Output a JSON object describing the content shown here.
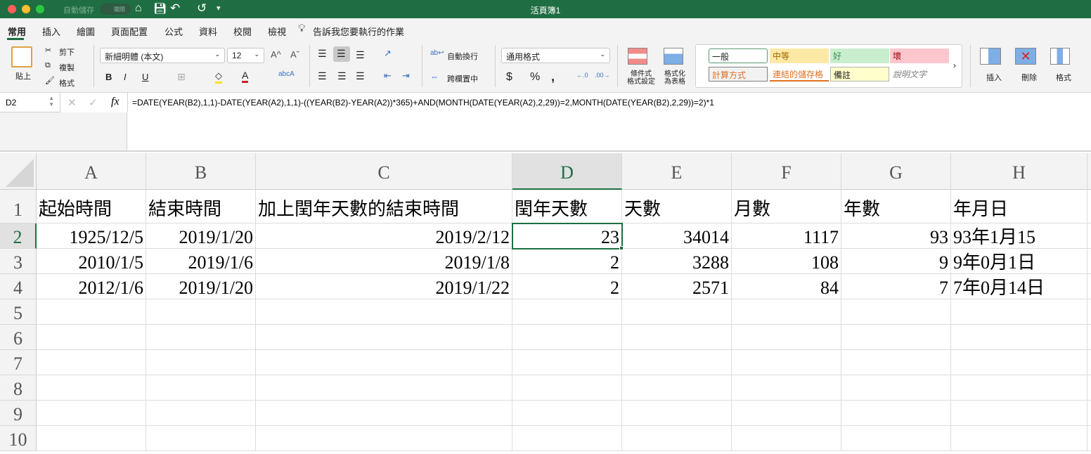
{
  "titlebar": {
    "title": "活頁簿1",
    "autosave_label": "自動儲存",
    "autosave_state": "關閉"
  },
  "tabs": [
    "常用",
    "插入",
    "繪圖",
    "頁面配置",
    "公式",
    "資料",
    "校閱",
    "檢視"
  ],
  "tell_me": "告訴我您要執行的作業",
  "ribbon": {
    "paste": "貼上",
    "cut": "剪下",
    "copy": "複製",
    "format_painter": "格式",
    "font_name": "新細明體 (本文)",
    "font_size": "12",
    "wrap_text": "自動換行",
    "merge_center": "跨欄置中",
    "number_format": "通用格式",
    "conditional_format": [
      "條件式",
      "格式設定"
    ],
    "format_as_table": [
      "格式化",
      "為表格"
    ],
    "styles": [
      "一般",
      "中等",
      "好",
      "壞",
      "計算方式",
      "連結的儲存格",
      "備註",
      "說明文字"
    ],
    "insert": "插入",
    "delete": "刪除",
    "format": "格式"
  },
  "formula_bar": {
    "name_box": "D2",
    "fx": "fx",
    "formula": "=DATE(YEAR(B2),1,1)-DATE(YEAR(A2),1,1)-((YEAR(B2)-YEAR(A2))*365)+AND(MONTH(DATE(YEAR(A2),2,29))=2,MONTH(DATE(YEAR(B2),2,29))=2)*1"
  },
  "sheet": {
    "columns": [
      "A",
      "B",
      "C",
      "D",
      "E",
      "F",
      "G",
      "H"
    ],
    "rows": [
      "1",
      "2",
      "3",
      "4",
      "5",
      "6",
      "7",
      "8",
      "9",
      "10"
    ],
    "selected": "D2",
    "cells": [
      [
        "起始時間",
        "結束時間",
        "加上閏年天數的結束時間",
        "閏年天數",
        "天數",
        "月數",
        "年數",
        "年月日"
      ],
      [
        "1925/12/5",
        "2019/1/20",
        "2019/2/12",
        "23",
        "34014",
        "1117",
        "93",
        "93年1月15"
      ],
      [
        "2010/1/5",
        "2019/1/6",
        "2019/1/8",
        "2",
        "3288",
        "108",
        "9",
        "9年0月1日"
      ],
      [
        "2012/1/6",
        "2019/1/20",
        "2019/1/22",
        "2",
        "2571",
        "84",
        "7",
        "7年0月14日"
      ]
    ]
  }
}
